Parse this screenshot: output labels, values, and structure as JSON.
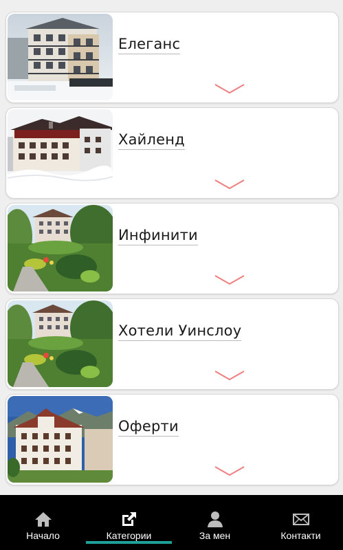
{
  "categories": [
    {
      "title": "Елеганс",
      "image": "hotel-winter-photo"
    },
    {
      "title": "Хайленд",
      "image": "hotel-snow-photo"
    },
    {
      "title": "Инфинити",
      "image": "hotel-garden-photo"
    },
    {
      "title": "Хотели Уинслоу",
      "image": "hotel-garden-photo"
    },
    {
      "title": "Оферти",
      "image": "hotel-mountain-photo"
    }
  ],
  "nav": {
    "items": [
      {
        "label": "Начало",
        "icon": "home-icon"
      },
      {
        "label": "Категории",
        "icon": "external-link-icon"
      },
      {
        "label": "За мен",
        "icon": "person-icon"
      },
      {
        "label": "Контакти",
        "icon": "envelope-icon"
      }
    ],
    "active_index": 1
  },
  "colors": {
    "chevron": "#f07d7d",
    "nav_background": "#000000",
    "nav_active_indicator": "#1ea297",
    "nav_icon": "#bdbdbd"
  }
}
